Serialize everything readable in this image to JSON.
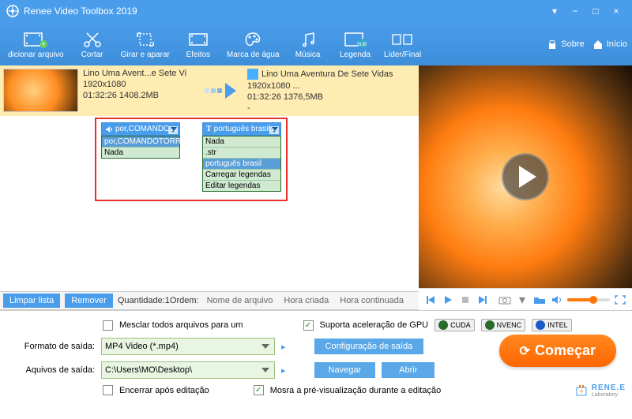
{
  "app": {
    "title": "Renee Video Toolbox 2019"
  },
  "titlebar_buttons": {
    "min": "−",
    "max": "□",
    "close": "×",
    "help": "▾"
  },
  "toolbar": {
    "add": "dicionar arquivo",
    "cut": "Cortar",
    "rotate": "Girar e aparar",
    "effects": "Efeitos",
    "watermark": "Marca de água",
    "music": "Música",
    "subtitle": "Legenda",
    "leader": "Líder/Final",
    "about": "Sobre",
    "home": "Início"
  },
  "item": {
    "src_name": "Lino Uma Avent...e Sete Vi",
    "src_res": "1920x1080",
    "src_dur": "01:32:26  1408.2MB",
    "out_name": "Lino Uma Aventura De Sete Vidas",
    "out_res": "1920x1080    ...",
    "out_dur": "01:32:26  1376,5MB",
    "ext": "-"
  },
  "audio_dd": {
    "head": "por,COMANDO",
    "items": [
      "por,COMANDOTORRE",
      "Nada"
    ]
  },
  "sub_dd": {
    "head": "português brasil",
    "items": [
      "Nada",
      ".str",
      "português brasil",
      "Carregar legendas",
      "Editar legendas"
    ],
    "selected": 2
  },
  "list_footer": {
    "clear": "Limpar lista",
    "remove": "Remover",
    "qty": "Quantidade:1Ordem:",
    "sort_name": "Nome de arquivo",
    "sort_created": "Hora criada",
    "sort_cont": "Hora continuada"
  },
  "options": {
    "merge": "Mesclar todos arquivos para um",
    "gpu": "Suporta aceleração de GPU",
    "cuda": "CUDA",
    "nvenc": "NVENC",
    "intel": "INTEL",
    "format_label": "Formato de saída:",
    "format_value": "MP4 Video (*.mp4)",
    "config": "Configuração de saída",
    "outpath_label": "Aquivos de saída:",
    "outpath_value": "C:\\Users\\MO\\Desktop\\",
    "browse": "Navegar",
    "open": "Abrir",
    "shutdown": "Encerrar após editação",
    "preview": "Mosra a pré-visualização durante a editação",
    "start": "Começar"
  },
  "brand": {
    "name": "RENE.E",
    "sub": "Laboratory"
  }
}
